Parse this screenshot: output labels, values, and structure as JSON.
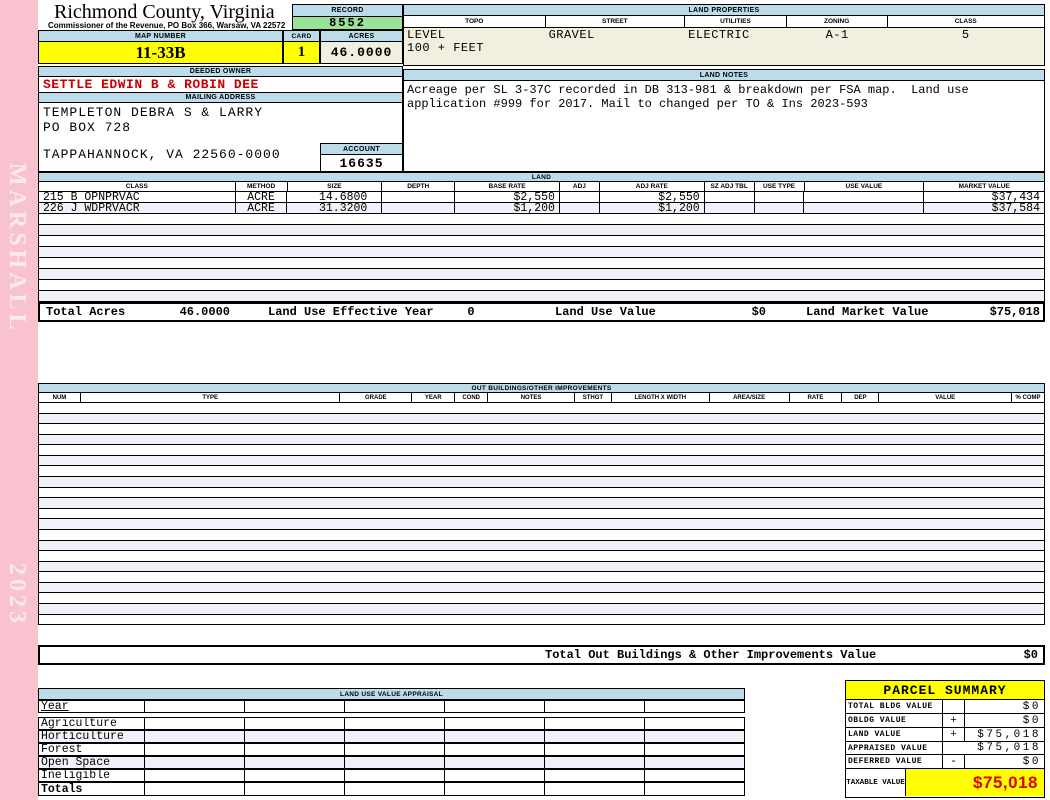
{
  "sidebar": {
    "top_text": "MARSHALL",
    "bottom_text": "2023"
  },
  "header": {
    "county": "Richmond County, Virginia",
    "subtitle": "Commissioner of the Revenue, PO Box 366, Warsaw, VA 22572",
    "record_label": "RECORD",
    "record_value": "8552",
    "map_number_label": "MAP NUMBER",
    "map_number_value": "11-33B",
    "card_label": "CARD",
    "card_value": "1",
    "acres_label": "ACRES",
    "acres_value": "46.0000"
  },
  "land_properties": {
    "title": "LAND PROPERTIES",
    "columns": [
      "TOPO",
      "STREET",
      "UTILITIES",
      "ZONING",
      "CLASS"
    ],
    "values": [
      "LEVEL",
      "GRAVEL",
      "ELECTRIC",
      "A-1",
      "5"
    ],
    "extra": "100 + FEET"
  },
  "owner": {
    "deeded_owner_label": "DEEDED OWNER",
    "deeded_owner": "SETTLE EDWIN B & ROBIN DEE",
    "mailing_address_label": "MAILING ADDRESS",
    "mailing_lines": [
      "TEMPLETON DEBRA S & LARRY",
      "PO BOX 728",
      "TAPPAHANNOCK, VA 22560-0000"
    ],
    "account_label": "ACCOUNT",
    "account_value": "16635"
  },
  "land_notes": {
    "title": "LAND NOTES",
    "text": "Acreage per SL 3-37C recorded in DB 313-981 & breakdown per FSA map.  Land use\napplication #999 for 2017. Mail to changed per TO & Ins 2023-593"
  },
  "land": {
    "title": "LAND",
    "columns": [
      "CLASS",
      "METHOD",
      "SIZE",
      "DEPTH",
      "BASE RATE",
      "ADJ",
      "ADJ RATE",
      "SZ ADJ TBL",
      "USE TYPE",
      "USE VALUE",
      "MARKET VALUE"
    ],
    "rows": [
      {
        "class": "215 B OPNPRVAC",
        "method": "ACRE",
        "size": "14.6800",
        "depth": "",
        "base_rate": "$2,550",
        "adj": "",
        "adj_rate": "$2,550",
        "sz_adj_tbl": "",
        "use_type": "",
        "use_value": "",
        "market_value": "$37,434"
      },
      {
        "class": "226 J WDPRVACR",
        "method": "ACRE",
        "size": "31.3200",
        "depth": "",
        "base_rate": "$1,200",
        "adj": "",
        "adj_rate": "$1,200",
        "sz_adj_tbl": "",
        "use_type": "",
        "use_value": "",
        "market_value": "$37,584"
      }
    ],
    "totals": {
      "total_acres_label": "Total Acres",
      "total_acres": "46.0000",
      "effective_year_label": "Land Use Effective Year",
      "effective_year": "0",
      "use_value_label": "Land Use Value",
      "use_value": "$0",
      "market_value_label": "Land Market Value",
      "market_value": "$75,018"
    }
  },
  "out_buildings": {
    "title": "OUT BUILDINGS/OTHER IMPROVEMENTS",
    "columns": [
      "NUM",
      "TYPE",
      "GRADE",
      "YEAR",
      "COND",
      "NOTES",
      "STHGT",
      "LENGTH X WIDTH",
      "AREA/SIZE",
      "RATE",
      "DEP",
      "VALUE",
      "% COMP"
    ],
    "total_label": "Total Out Buildings & Other Improvements Value",
    "total_value": "$0"
  },
  "land_use_appraisal": {
    "title": "LAND USE VALUE APPRAISAL",
    "row_labels": [
      "Year",
      "Agriculture",
      "Horticulture",
      "Forest",
      "Open Space",
      "Ineligible",
      "Totals"
    ]
  },
  "parcel_summary": {
    "title": "PARCEL SUMMARY",
    "rows": [
      {
        "label": "TOTAL BLDG VALUE",
        "op": "",
        "value": "$0"
      },
      {
        "label": "OBLDG VALUE",
        "op": "+",
        "value": "$0"
      },
      {
        "label": "LAND VALUE",
        "op": "+",
        "value": "$75,018"
      },
      {
        "label": "APPRAISED VALUE",
        "op": "",
        "value": "$75,018"
      },
      {
        "label": "DEFERRED VALUE",
        "op": "-",
        "value": "$0"
      }
    ],
    "taxable_label": "TAXABLE VALUE",
    "taxable_value": "$75,018"
  },
  "colors": {
    "sidebar_pink": "#F8C2CE",
    "section_blue": "#BCDCEA",
    "record_green": "#99E399",
    "highlight_yellow": "#FFFF00",
    "beige": "#F0EFE0",
    "owner_red": "#CC0000",
    "taxable_red": "#DD0000"
  }
}
